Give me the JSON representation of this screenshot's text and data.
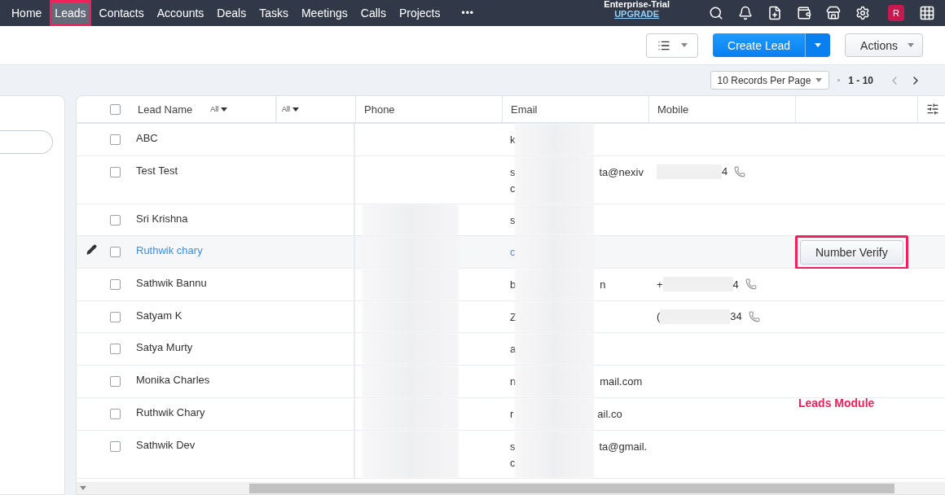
{
  "nav": {
    "tabs": [
      {
        "label": "Home",
        "selected": false,
        "highlighted": false
      },
      {
        "label": "Leads",
        "selected": true,
        "highlighted": true
      },
      {
        "label": "Contacts",
        "selected": false,
        "highlighted": false
      },
      {
        "label": "Accounts",
        "selected": false,
        "highlighted": false
      },
      {
        "label": "Deals",
        "selected": false,
        "highlighted": false
      },
      {
        "label": "Tasks",
        "selected": false,
        "highlighted": false
      },
      {
        "label": "Meetings",
        "selected": false,
        "highlighted": false
      },
      {
        "label": "Calls",
        "selected": false,
        "highlighted": false
      },
      {
        "label": "Projects",
        "selected": false,
        "highlighted": false
      }
    ],
    "more": "•••",
    "plan": "Enterprise-Trial",
    "upgrade": "UPGRADE",
    "avatar": "R"
  },
  "toolbar": {
    "create": "Create Lead",
    "actions": "Actions"
  },
  "pager": {
    "per_page": "10 Records Per Page",
    "range": "1 - 10"
  },
  "table": {
    "all_checked": false,
    "columns": [
      {
        "label": "Lead Name",
        "filter": "All"
      },
      {
        "filter": "All"
      },
      {
        "label": "Phone"
      },
      {
        "label": "Email"
      },
      {
        "label": "Mobile"
      }
    ],
    "rows": [
      {
        "name": "ABC",
        "checked": false,
        "hovered": false,
        "phone_blurred": false,
        "email": "k"
      },
      {
        "name": "Test Test",
        "checked": false,
        "hovered": false,
        "phone_blurred": false,
        "email": "s",
        "email_end": "ta@nexiv",
        "email_line2": "c",
        "mobile_end": "4"
      },
      {
        "name": "Sri Krishna",
        "checked": false,
        "hovered": false,
        "phone_blurred": true,
        "email": "s"
      },
      {
        "name": "Ruthwik chary",
        "checked": false,
        "hovered": true,
        "phone_blurred": true,
        "email": "c",
        "button": {
          "label": "Number Verify",
          "highlighted": true
        }
      },
      {
        "name": "Sathwik Bannu",
        "checked": false,
        "hovered": false,
        "phone_blurred": true,
        "email": "b",
        "email_end": "n",
        "mobile": "+",
        "mobile_end": "4"
      },
      {
        "name": "Satyam K",
        "checked": false,
        "hovered": false,
        "phone_blurred": true,
        "email": "Z",
        "mobile": "(",
        "mobile_end": "34"
      },
      {
        "name": "Satya Murty",
        "checked": false,
        "hovered": false,
        "phone_blurred": true,
        "email": "a"
      },
      {
        "name": "Monika Charles",
        "checked": false,
        "hovered": false,
        "phone_blurred": true,
        "email": "n",
        "email_end": "mail.com"
      },
      {
        "name": "Ruthwik Chary",
        "checked": false,
        "hovered": false,
        "phone_blurred": true,
        "email": "r",
        "email_end": "ail.co"
      },
      {
        "name": "Sathwik Dev",
        "checked": false,
        "hovered": false,
        "phone_blurred": true,
        "email": "s",
        "email_end": "ta@gmail.",
        "email_line2": "c"
      }
    ]
  },
  "annotation": "Leads Module"
}
